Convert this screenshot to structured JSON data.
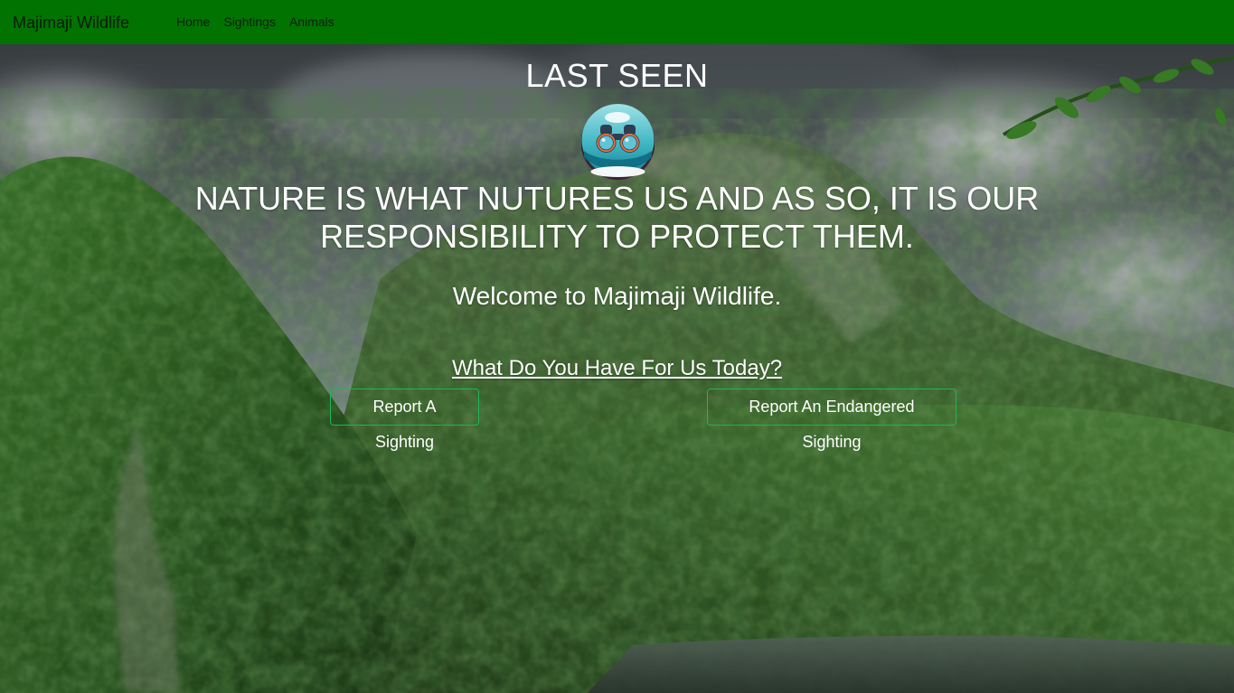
{
  "nav": {
    "brand": "Majimaji Wildlife",
    "links": [
      {
        "label": "Home"
      },
      {
        "label": "Sightings"
      },
      {
        "label": "Animals"
      }
    ],
    "background_color": "#017301"
  },
  "hero": {
    "title": "LAST SEEN",
    "logo_icon": "binoculars-icon",
    "motto": "NATURE IS WHAT NUTURES US AND AS SO, IT IS OUR RESPONSIBILITY TO PROTECT THEM.",
    "welcome": "Welcome to Majimaji Wildlife.",
    "prompt": "What Do You Have For Us Today?",
    "background": "forest-mountain-photo",
    "text_color": "#ffffff"
  },
  "actions": {
    "report_sighting": "Report A Sighting",
    "report_endangered": "Report An Endangered Sighting",
    "border_color": "#1bb65a"
  }
}
